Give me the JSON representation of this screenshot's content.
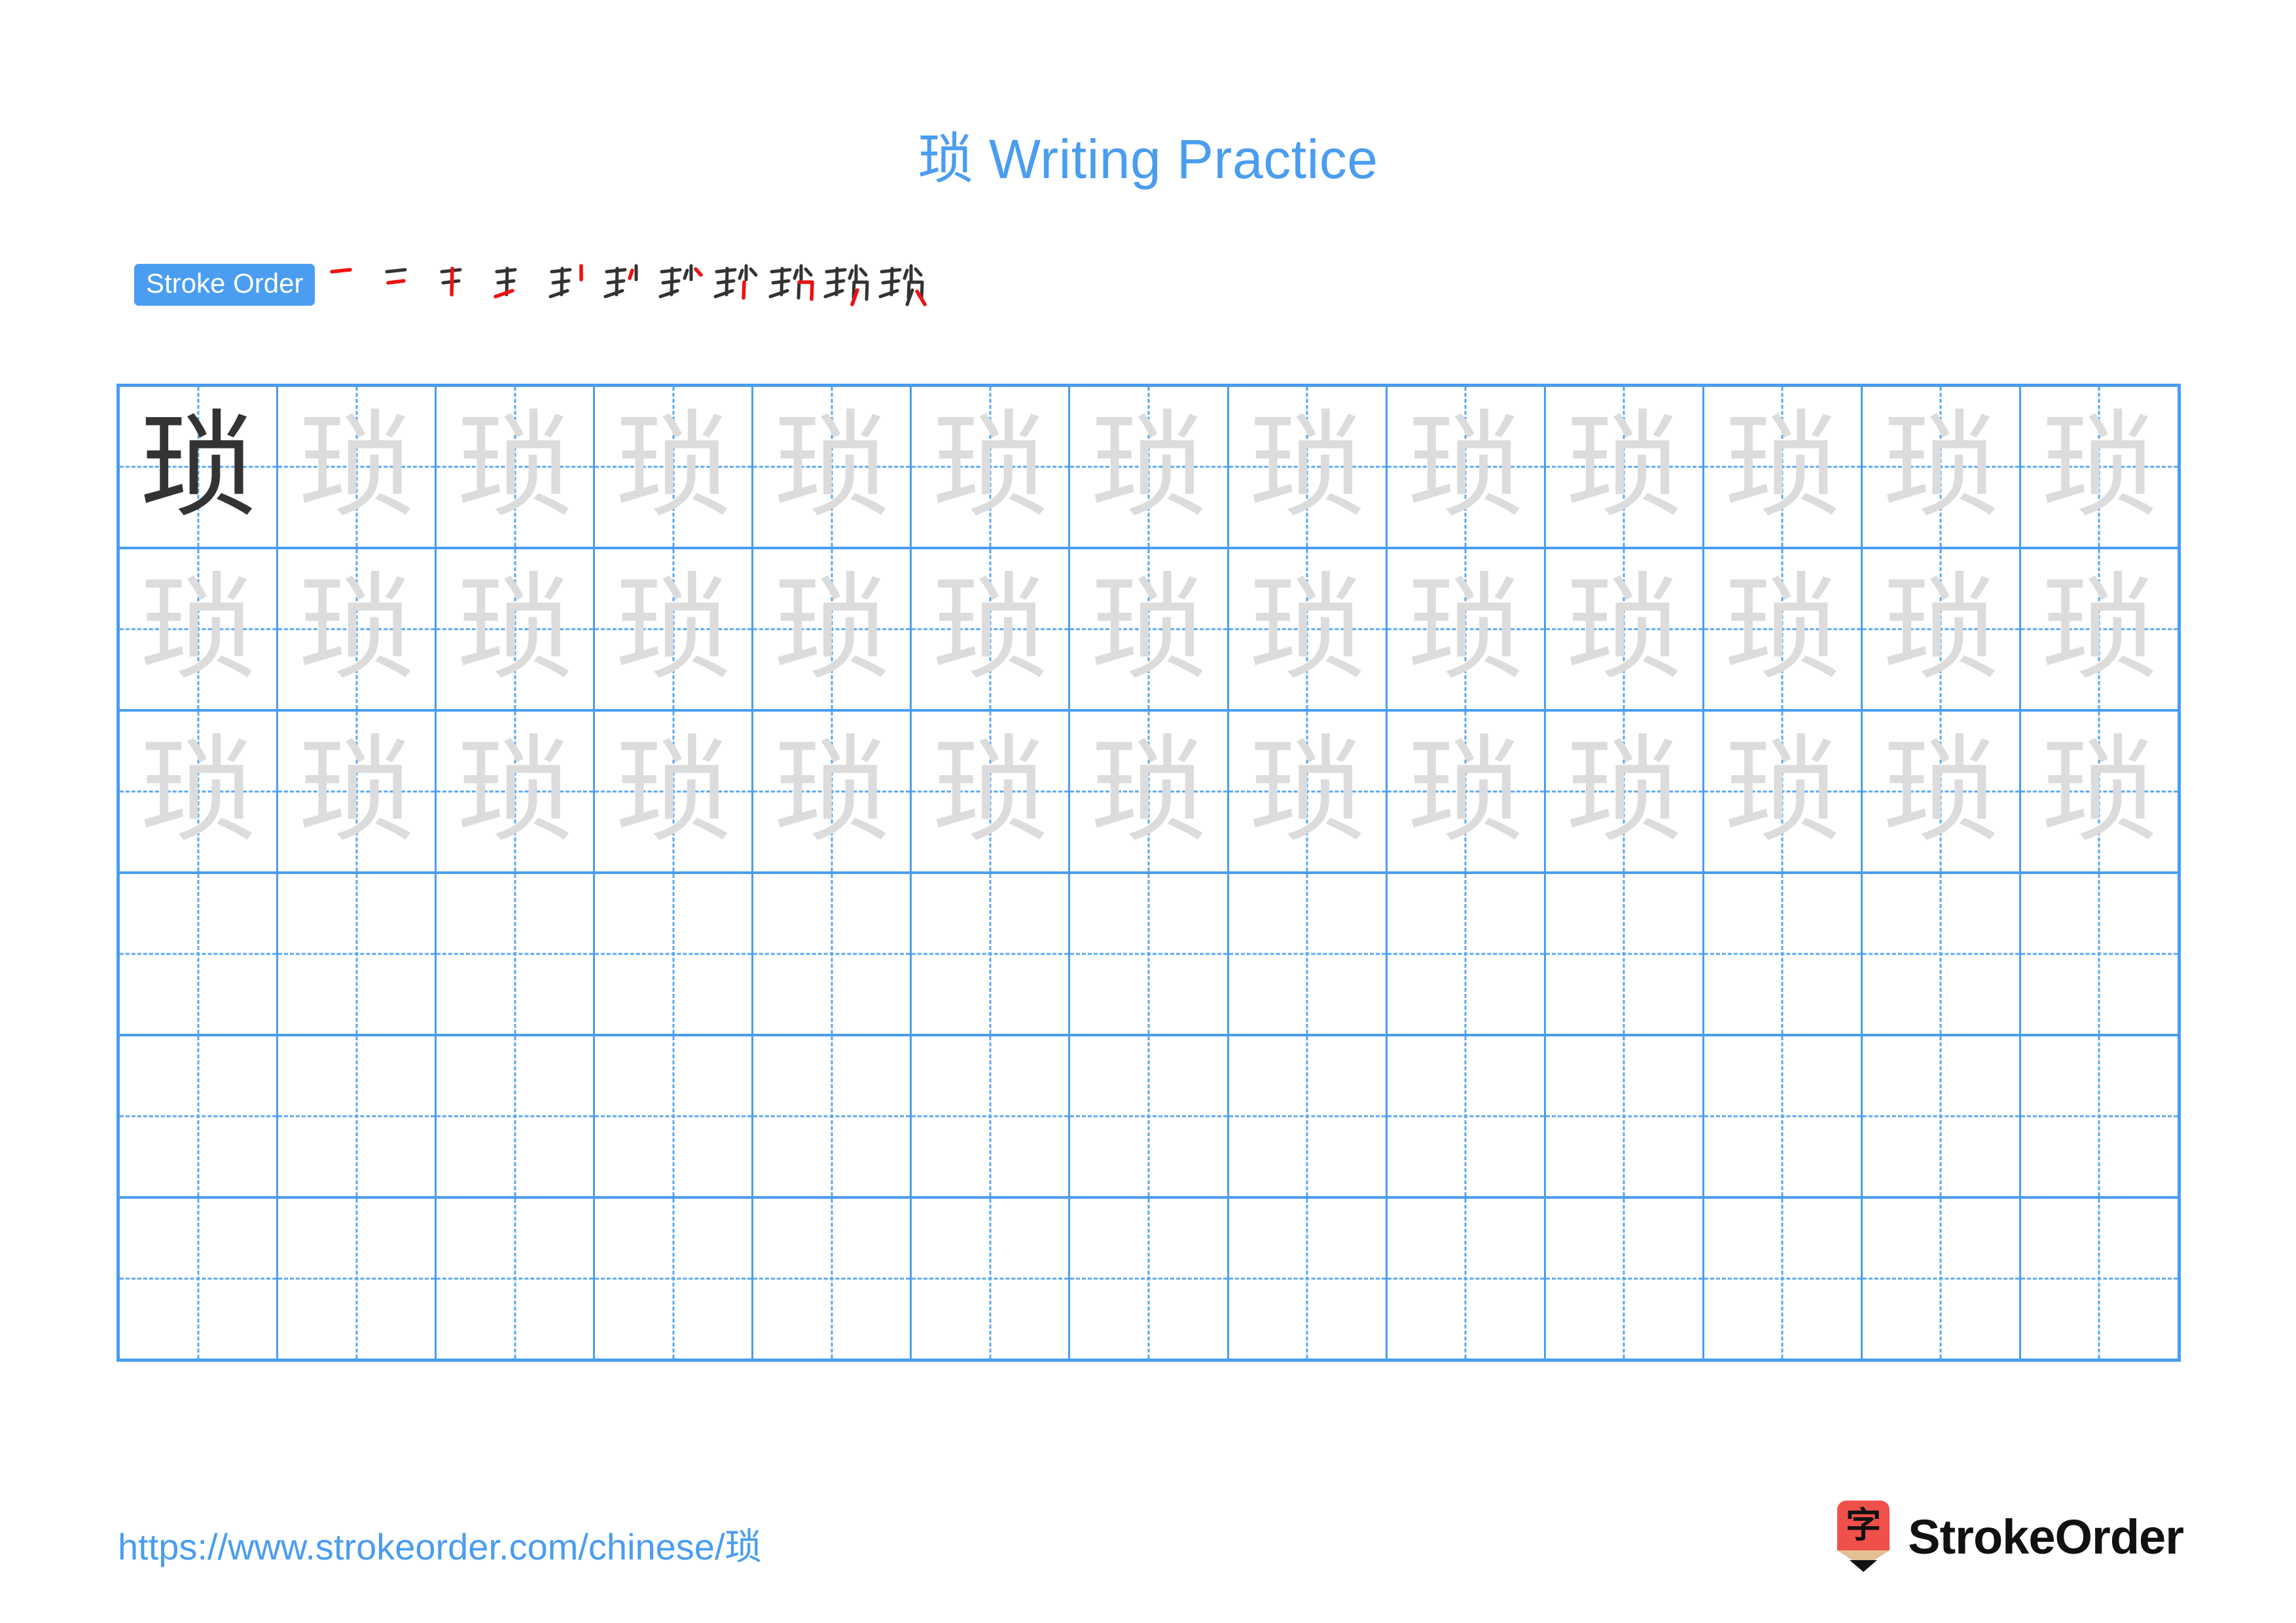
{
  "character": "琐",
  "page": {
    "title": "琐 Writing Practice",
    "background_color": "#ffffff"
  },
  "colors": {
    "accent_blue": "#4a9df0",
    "grid_line": "#4a9df0",
    "guide_dash": "#5aa8f2",
    "solid_char": "#333333",
    "trace_char": "#dcdcdc",
    "new_stroke_red": "#ee1111",
    "done_stroke_dark": "#333333",
    "logo_red": "#f0504a",
    "logo_wood": "#e3bf93"
  },
  "stroke_order": {
    "badge_label": "Stroke Order",
    "total_strokes": 11,
    "steps": [
      {
        "index": 1,
        "strokes_done": 0,
        "new_stroke": 1
      },
      {
        "index": 2,
        "strokes_done": 1,
        "new_stroke": 2
      },
      {
        "index": 3,
        "strokes_done": 2,
        "new_stroke": 3
      },
      {
        "index": 4,
        "strokes_done": 3,
        "new_stroke": 4
      },
      {
        "index": 5,
        "strokes_done": 4,
        "new_stroke": 5
      },
      {
        "index": 6,
        "strokes_done": 5,
        "new_stroke": 6
      },
      {
        "index": 7,
        "strokes_done": 6,
        "new_stroke": 7
      },
      {
        "index": 8,
        "strokes_done": 7,
        "new_stroke": 8
      },
      {
        "index": 9,
        "strokes_done": 8,
        "new_stroke": 9
      },
      {
        "index": 10,
        "strokes_done": 9,
        "new_stroke": 10
      },
      {
        "index": 11,
        "strokes_done": 10,
        "new_stroke": 11
      }
    ]
  },
  "practice_grid": {
    "columns": 13,
    "rows": 6,
    "rows_data": [
      {
        "row": 1,
        "cells": [
          "solid",
          "trace",
          "trace",
          "trace",
          "trace",
          "trace",
          "trace",
          "trace",
          "trace",
          "trace",
          "trace",
          "trace",
          "trace"
        ]
      },
      {
        "row": 2,
        "cells": [
          "trace",
          "trace",
          "trace",
          "trace",
          "trace",
          "trace",
          "trace",
          "trace",
          "trace",
          "trace",
          "trace",
          "trace",
          "trace"
        ]
      },
      {
        "row": 3,
        "cells": [
          "trace",
          "trace",
          "trace",
          "trace",
          "trace",
          "trace",
          "trace",
          "trace",
          "trace",
          "trace",
          "trace",
          "trace",
          "trace"
        ]
      },
      {
        "row": 4,
        "cells": [
          "blank",
          "blank",
          "blank",
          "blank",
          "blank",
          "blank",
          "blank",
          "blank",
          "blank",
          "blank",
          "blank",
          "blank",
          "blank"
        ]
      },
      {
        "row": 5,
        "cells": [
          "blank",
          "blank",
          "blank",
          "blank",
          "blank",
          "blank",
          "blank",
          "blank",
          "blank",
          "blank",
          "blank",
          "blank",
          "blank"
        ]
      },
      {
        "row": 6,
        "cells": [
          "blank",
          "blank",
          "blank",
          "blank",
          "blank",
          "blank",
          "blank",
          "blank",
          "blank",
          "blank",
          "blank",
          "blank",
          "blank"
        ]
      }
    ]
  },
  "footer": {
    "url": "https://www.strokeorder.com/chinese/琐",
    "brand_name": "StrokeOrder",
    "logo_glyph": "字"
  }
}
